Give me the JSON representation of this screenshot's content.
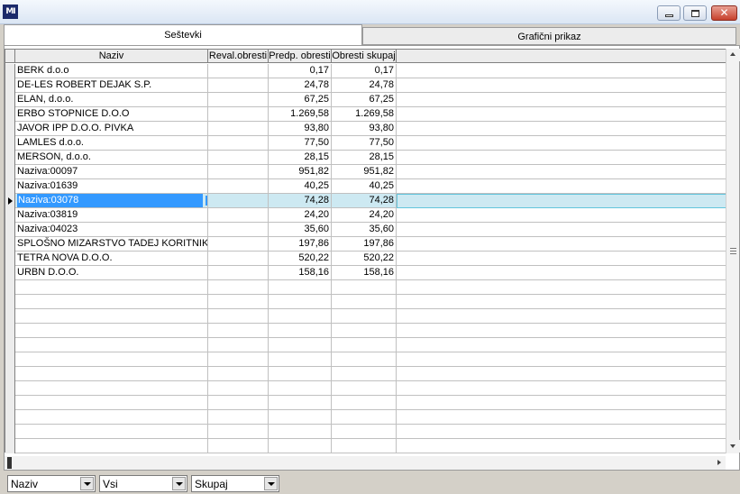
{
  "window": {
    "app_logo": "MI",
    "close_glyph": "✕"
  },
  "tabs": [
    {
      "label": "Seštevki",
      "active": true
    },
    {
      "label": "Grafični prikaz",
      "active": false
    }
  ],
  "grid": {
    "columns": [
      "Naziv",
      "Reval.obresti",
      "Predp. obresti",
      "Obresti skupaj"
    ],
    "rows": [
      {
        "naziv": "BERK d.o.o",
        "reval": "",
        "predp": "0,17",
        "skupaj": "0,17"
      },
      {
        "naziv": "DE-LES ROBERT DEJAK S.P.",
        "reval": "",
        "predp": "24,78",
        "skupaj": "24,78"
      },
      {
        "naziv": "ELAN, d.o.o.",
        "reval": "",
        "predp": "67,25",
        "skupaj": "67,25"
      },
      {
        "naziv": "ERBO STOPNICE D.O.O",
        "reval": "",
        "predp": "1.269,58",
        "skupaj": "1.269,58"
      },
      {
        "naziv": "JAVOR IPP  D.O.O. PIVKA",
        "reval": "",
        "predp": "93,80",
        "skupaj": "93,80"
      },
      {
        "naziv": "LAMLES d.o.o.",
        "reval": "",
        "predp": "77,50",
        "skupaj": "77,50"
      },
      {
        "naziv": "MERSON, d.o.o.",
        "reval": "",
        "predp": "28,15",
        "skupaj": "28,15"
      },
      {
        "naziv": "Naziva:00097",
        "reval": "",
        "predp": "951,82",
        "skupaj": "951,82"
      },
      {
        "naziv": "Naziva:01639",
        "reval": "",
        "predp": "40,25",
        "skupaj": "40,25"
      },
      {
        "naziv": "Naziva:03078",
        "reval": "",
        "predp": "74,28",
        "skupaj": "74,28",
        "selected": true
      },
      {
        "naziv": "Naziva:03819",
        "reval": "",
        "predp": "24,20",
        "skupaj": "24,20"
      },
      {
        "naziv": "Naziva:04023",
        "reval": "",
        "predp": "35,60",
        "skupaj": "35,60"
      },
      {
        "naziv": "SPLOŠNO MIZARSTVO TADEJ KORITNIK",
        "reval": "",
        "predp": "197,86",
        "skupaj": "197,86"
      },
      {
        "naziv": "TETRA NOVA D.O.O.",
        "reval": "",
        "predp": "520,22",
        "skupaj": "520,22"
      },
      {
        "naziv": "URBN D.O.O.",
        "reval": "",
        "predp": "158,16",
        "skupaj": "158,16"
      }
    ],
    "selected_index": 9
  },
  "filters": [
    {
      "name": "naziv-combo",
      "value": "Naziv"
    },
    {
      "name": "vsi-combo",
      "value": "Vsi"
    },
    {
      "name": "skupaj-combo",
      "value": "Skupaj"
    }
  ],
  "colors": {
    "selection_text_bg": "#3399ff",
    "selection_row_bg": "#cde9f2",
    "close_button": "#c7402c"
  }
}
